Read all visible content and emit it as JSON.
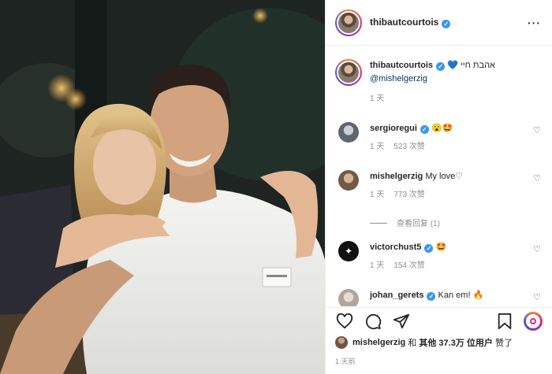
{
  "post": {
    "author": "thibautcourtois",
    "more_glyph": "···"
  },
  "caption": {
    "username": "thibautcourtois",
    "hebrew_text": "אהבת חיי",
    "heart": "💙",
    "mention": "@mishelgerzig",
    "time": "1 天"
  },
  "comments": [
    {
      "username": "sergioregui",
      "verified": true,
      "text": "😮🤩",
      "time": "1 天",
      "likes": "523 次赞"
    },
    {
      "username": "mishelgerzig",
      "verified": false,
      "text": "My love♡",
      "time": "1 天",
      "likes": "773 次赞",
      "replies": "查看回复 (1)"
    },
    {
      "username": "victorchust5",
      "verified": true,
      "text": "🤩",
      "time": "1 天",
      "likes": "154 次赞"
    },
    {
      "username": "johan_gerets",
      "verified": true,
      "text": "Kan em! 🔥",
      "time": "",
      "likes": ""
    }
  ],
  "likes_line": {
    "user": "mishelgerzig",
    "and": " 和 ",
    "others": "其他 37.3万 位用户",
    "suffix": " 赞了"
  },
  "date": "1 天前",
  "icons": [
    "heart-icon",
    "comment-icon",
    "share-icon",
    "bookmark-icon",
    "reel-icon"
  ],
  "colors": {
    "verified": "#3897f0",
    "mention": "#00376b",
    "muted": "#8e8e8e"
  }
}
